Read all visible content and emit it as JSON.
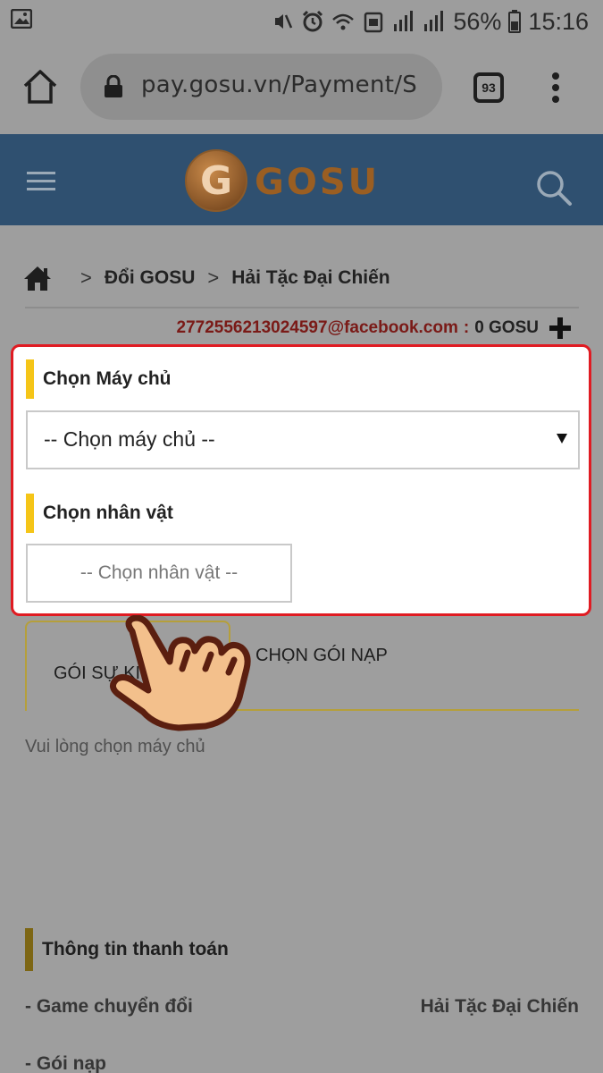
{
  "status_bar": {
    "battery": "56%",
    "time": "15:16",
    "icons": [
      "gallery-icon",
      "mute-icon",
      "alarm-icon",
      "wifi-icon",
      "hd-icon",
      "signal-icon",
      "signal-icon",
      "battery-icon"
    ]
  },
  "browser": {
    "url": "pay.gosu.vn/Payment/S",
    "tab_count": "93"
  },
  "site": {
    "logo_text": "GOSU",
    "colors": {
      "header": "#2f5070",
      "accent_yellow": "#f5c518",
      "highlight_red": "#e01b22"
    }
  },
  "breadcrumb": {
    "items": [
      "Đổi GOSU",
      "Hải Tặc Đại Chiến"
    ],
    "separator": ">"
  },
  "account": {
    "email": "2772556213024597@facebook.com",
    "separator": ":",
    "balance": "0 GOSU"
  },
  "server_section": {
    "title": "Chọn Máy chủ",
    "selected": "-- Chọn máy chủ --"
  },
  "character_section": {
    "title": "Chọn nhân vật",
    "selected": "-- Chọn nhân vật --"
  },
  "tabs": {
    "event": "GÓI SỰ KIỆN",
    "package": "CHỌN GÓI NẠP"
  },
  "note": "Vui lòng chọn máy chủ",
  "payment_info": {
    "title": "Thông tin thanh toán",
    "rows": [
      {
        "label": "- Game chuyển đổi",
        "value": "Hải Tặc Đại Chiến"
      },
      {
        "label": "- Gói nạp",
        "value": ""
      }
    ]
  }
}
